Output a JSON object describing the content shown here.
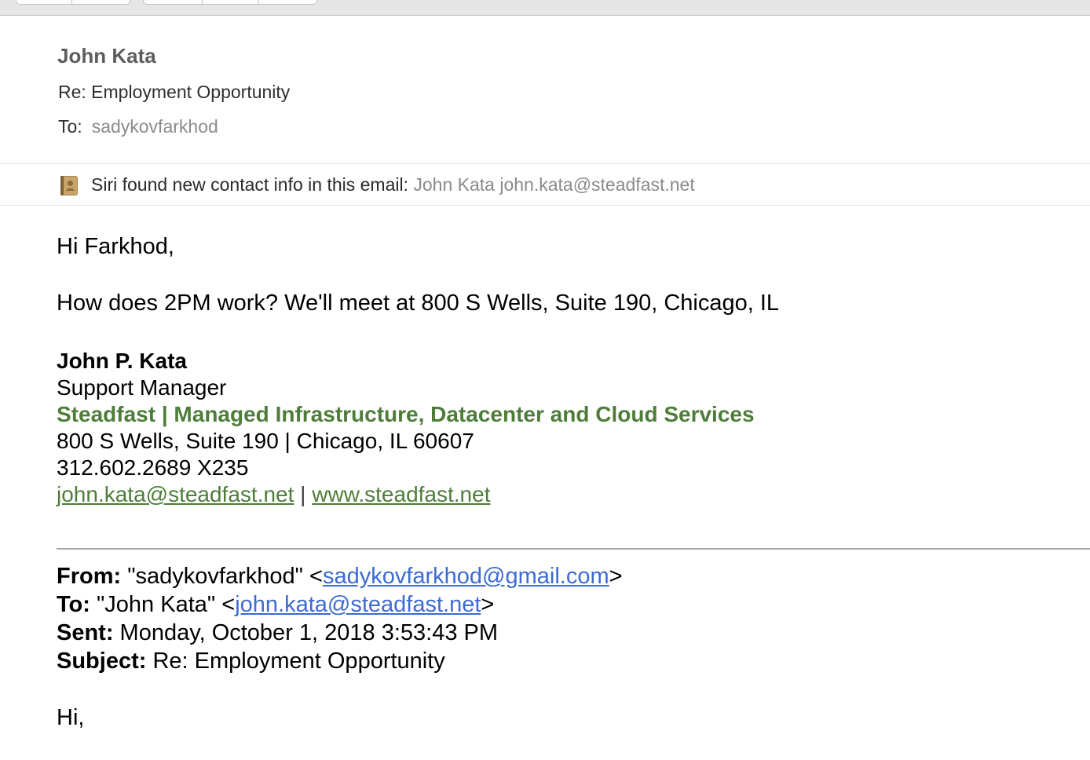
{
  "header": {
    "sender_name": "John Kata",
    "subject": "Re: Employment Opportunity",
    "to_label": "To:",
    "to_value": "sadykovfarkhod"
  },
  "siri_banner": {
    "icon": "contacts-book-icon",
    "message": "Siri found new contact info in this email:",
    "contact": "John Kata john.kata@steadfast.net"
  },
  "body": {
    "greeting": "Hi Farkhod,",
    "message": "How does 2PM work?  We'll meet at 800 S Wells, Suite 190, Chicago, IL"
  },
  "signature": {
    "name": "John P. Kata",
    "title": "Support Manager",
    "company": "Steadfast | Managed Infrastructure, Datacenter and Cloud Services",
    "address": "800 S Wells, Suite 190 | Chicago, IL 60607",
    "phone": "312.602.2689 X235",
    "email_link": "john.kata@steadfast.net",
    "link_separator": " | ",
    "website_link": "www.steadfast.net"
  },
  "quoted": {
    "from_label": "From:",
    "from_name": " \"sadykovfarkhod\" <",
    "from_email": "sadykovfarkhod@gmail.com",
    "from_close": ">",
    "to_label": "To:",
    "to_name": " \"John Kata\" <",
    "to_email": "john.kata@steadfast.net",
    "to_close": ">",
    "sent_label": "Sent:",
    "sent_value": " Monday, October 1, 2018 3:53:43 PM",
    "subject_label": "Subject:",
    "subject_value": " Re: Employment Opportunity",
    "salutation": "Hi,"
  },
  "colors": {
    "company_green": "#4e7d3a",
    "link_blue": "#3c6bd1",
    "muted_gray": "#8b8b8b"
  }
}
